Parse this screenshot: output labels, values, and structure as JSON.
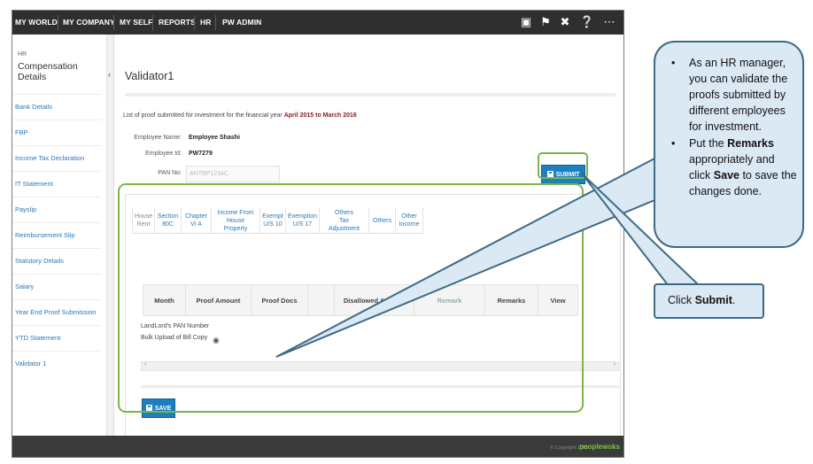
{
  "topbar": {
    "nav": [
      "MY WORLD",
      "MY COMPANY",
      "MY SELF",
      "REPORTS",
      "HR",
      "PW ADMIN"
    ],
    "icons": [
      "book-icon",
      "flag-icon",
      "tools-icon",
      "help-icon",
      "share-icon"
    ]
  },
  "sidebar": {
    "section_small": "HR",
    "section_title": "Compensation Details",
    "items": [
      "Bank Details",
      "FBP",
      "Income Tax Declaration",
      "IT Statement",
      "Payslip",
      "Reimbursement Slip",
      "Statutory Details",
      "Salary",
      "Year End Proof Submission",
      "YTD Statement",
      "Validator 1"
    ]
  },
  "main": {
    "title": "Validator1",
    "list_prefix": "List of proof submitted for investment for the financial year ",
    "list_year": "April 2015 to March 2016",
    "employee_name_label": "Employee Name:",
    "employee_name": "Employee Shashi",
    "employee_id_label": "Employee Id:",
    "employee_id": "PW7279",
    "pan_label": "PAN No:",
    "pan_value": "ANTBP1234C",
    "submit_label": "SUBMIT",
    "save_label": "SAVE",
    "tabs": [
      {
        "l1": "House",
        "l2": "Rent"
      },
      {
        "l1": "Section",
        "l2": "80C"
      },
      {
        "l1": "Chapter",
        "l2": "VI A"
      },
      {
        "l1": "Income From",
        "l2": "House Property"
      },
      {
        "l1": "Exempt",
        "l2": "U/S 10"
      },
      {
        "l1": "Exemption",
        "l2": "U/S 17"
      },
      {
        "l1": "Others",
        "l2": "Tax Adjustment"
      },
      {
        "l1": "Others",
        "l2": ""
      },
      {
        "l1": "Other",
        "l2": "Income"
      }
    ],
    "columns": [
      "Month",
      "Proof Amount",
      "Proof Docs",
      "",
      "Disallowed Amount",
      "Remark",
      "Remarks",
      "View"
    ],
    "rows": [
      "LandLord's PAN Number",
      "Bulk Upload of Bill Copy"
    ],
    "scroll_left": "‹",
    "scroll_right": "›"
  },
  "footer": {
    "copyright": "© Copyright 2015",
    "brand": "peoplewoks"
  },
  "annotations": {
    "callout1_items": [
      "As an HR manager, you can validate the proofs submitted by different employees for investment.",
      "Put the Remarks appropriately and click Save to save the changes done."
    ],
    "callout2": "Click Submit."
  },
  "colors": {
    "accent": "#1e7fc0",
    "annotation_green": "#7ab648",
    "callout_fill": "#dbe9f5",
    "year_text": "#8b1a1a"
  }
}
